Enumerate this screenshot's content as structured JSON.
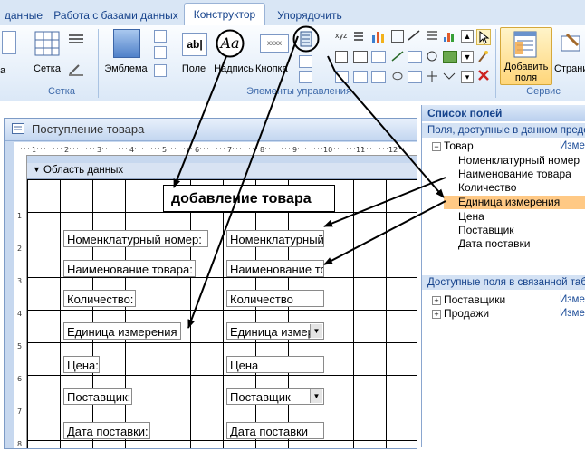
{
  "ribbon": {
    "tabs": [
      "данные",
      "Работа с базами данных",
      "Конструктор",
      "Упорядочить"
    ],
    "active_tab": "Конструктор",
    "buttons": {
      "grid": "Сетка",
      "logo": "Эмблема",
      "field": "Поле",
      "label": "Надпись",
      "button": "Кнопка",
      "add_fields": "Добавить поля",
      "page": "Страни"
    },
    "textbox_icon_text": "ab|",
    "label_icon_text": "Aa",
    "button_icon_text": "xxxx",
    "groups": {
      "grid": "Сетка",
      "controls": "Элементы управления",
      "service": "Сервис"
    }
  },
  "form": {
    "title": "Поступление товара",
    "section": "Область данных",
    "header_label": "добавление товара",
    "rows": [
      {
        "label": "Номенклатурный номер:",
        "field": "Номенклатурный",
        "combo": false
      },
      {
        "label": "Наименование товара:",
        "field": "Наименование то",
        "combo": false
      },
      {
        "label": "Количество:",
        "field": "Количество",
        "combo": false
      },
      {
        "label": "Единица измерения",
        "field": "Единица измер",
        "combo": true
      },
      {
        "label": "Цена:",
        "field": "Цена",
        "combo": false
      },
      {
        "label": "Поставщик:",
        "field": "Поставщик",
        "combo": true
      },
      {
        "label": "Дата поставки:",
        "field": "Дата поставки",
        "combo": false
      }
    ]
  },
  "field_list": {
    "title": "Список полей",
    "available_header": "Поля, доступные в данном предст",
    "table": "Товар",
    "edit_link": "Изме",
    "fields": [
      "Номенклатурный номер",
      "Наименование товара",
      "Количество",
      "Единица измерения",
      "Цена",
      "Поставщик",
      "Дата поставки"
    ],
    "selected_field": "Единица измерения",
    "related_header": "Доступные поля в связанной табл",
    "related": [
      {
        "name": "Поставщики",
        "link": "Изме"
      },
      {
        "name": "Продажи",
        "link": "Изме"
      }
    ]
  },
  "colors": {
    "ribbon_text": "#15428b",
    "selected_field_bg": "#ffc985",
    "arrow": "#000000"
  }
}
